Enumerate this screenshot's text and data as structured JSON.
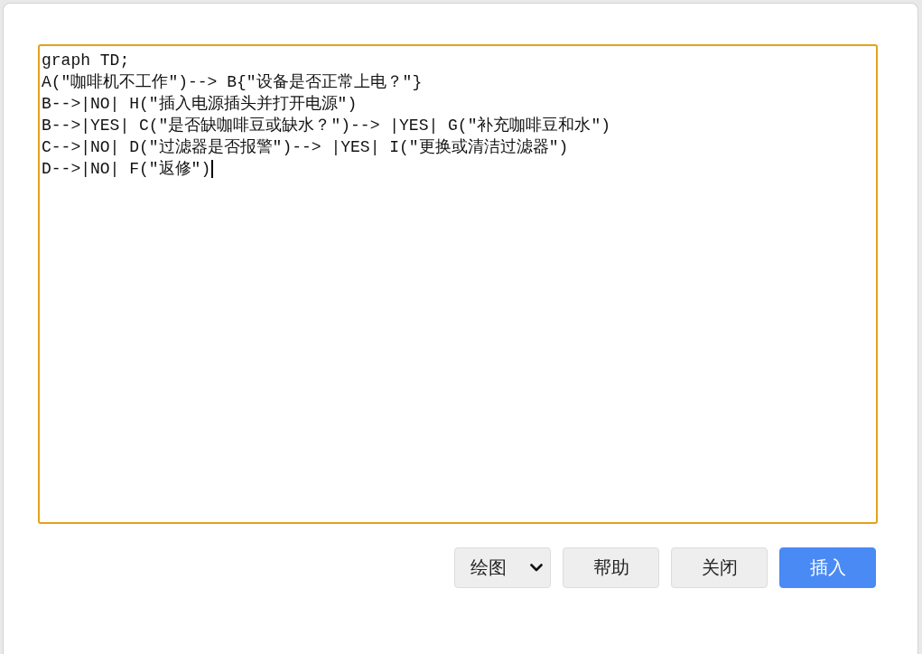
{
  "editor": {
    "focused": true,
    "lines": [
      "graph TD;",
      "A(\"咖啡机不工作\")--> B{\"设备是否正常上电？\"}",
      "B-->|NO| H(\"插入电源插头并打开电源\")",
      "B-->|YES| C(\"是否缺咖啡豆或缺水？\")--> |YES| G(\"补充咖啡豆和水\")",
      "C-->|NO| D(\"过滤器是否报警\")--> |YES| I(\"更换或清洁过滤器\")",
      "D-->|NO| F(\"返修\")"
    ]
  },
  "type_select": {
    "value": "绘图"
  },
  "buttons": [
    {
      "label": "帮助",
      "kind": "secondary"
    },
    {
      "label": "关闭",
      "kind": "secondary"
    },
    {
      "label": "插入",
      "kind": "primary"
    }
  ]
}
